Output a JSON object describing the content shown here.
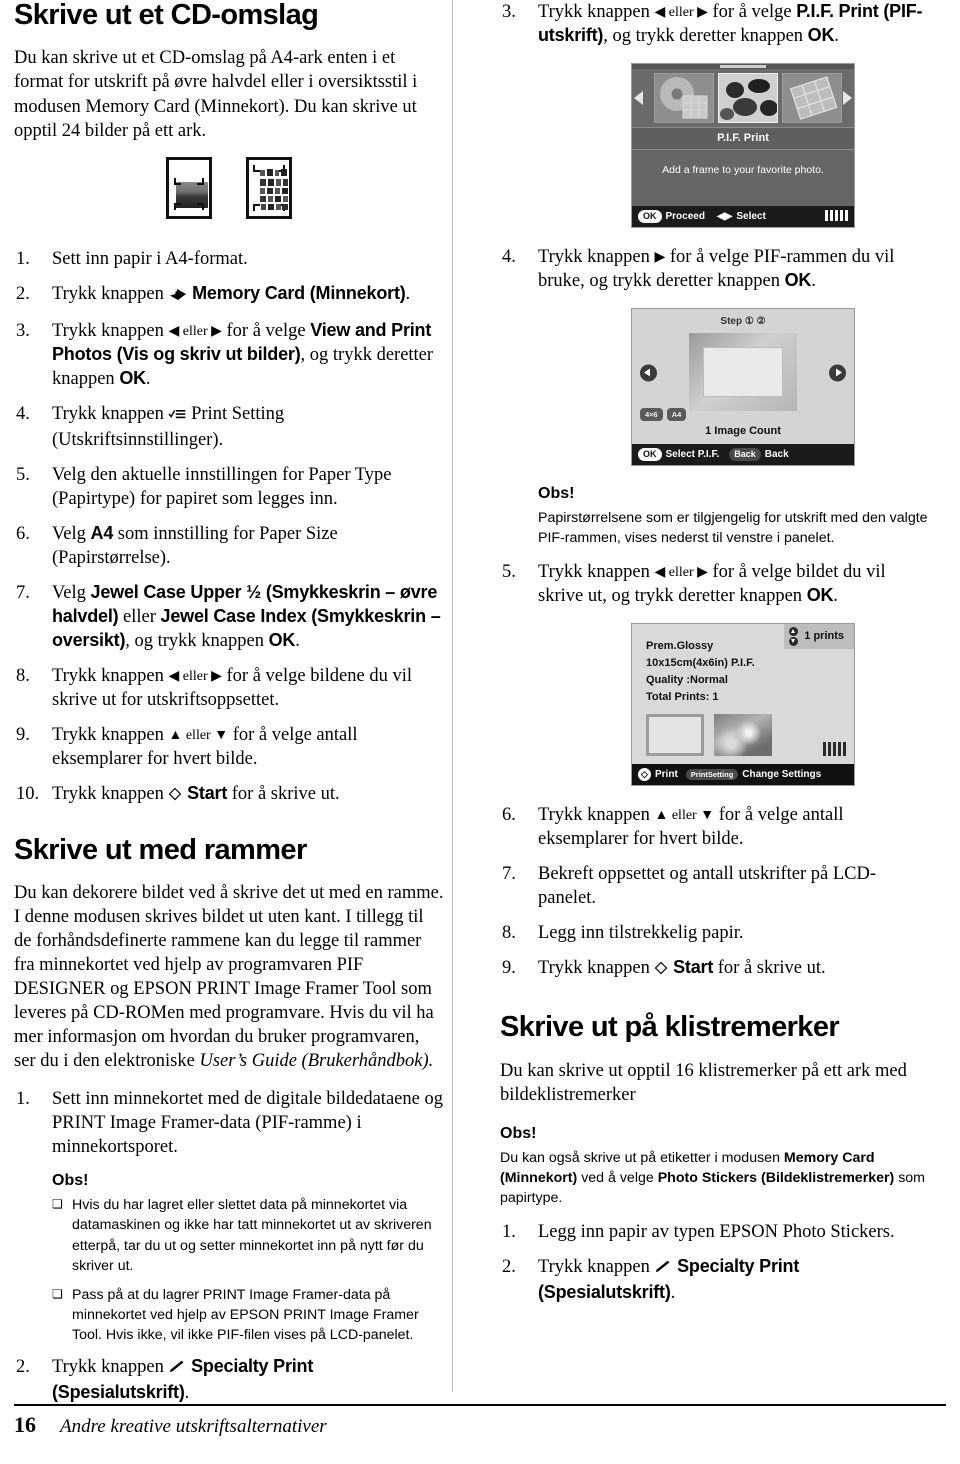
{
  "left_column": {
    "heading": "Skrive ut et CD-omslag",
    "intro": "Du kan skrive ut et CD-omslag på A4-ark enten i et format for utskrift på øvre halvdel eller i oversiktsstil i modusen Memory Card (Minnekort). Du kan skrive ut opptil 24 bilder på ett ark.",
    "steps": [
      {
        "num": "1.",
        "text": "Sett inn papir i A4-format."
      },
      {
        "num": "2.",
        "text": "Trykk knappen ",
        "icon": "memory-card-icon",
        "bold_sans": "Memory Card (Minnekort)",
        "tail": "."
      },
      {
        "num": "3.",
        "pre": "Trykk knappen ",
        "arrows": "◀ eller ▶",
        "mid": " for å velge ",
        "bold_sans": "View and Print Photos (Vis og skriv ut bilder)",
        "post": ", og trykk deretter knappen ",
        "bold_key": "OK",
        "tail": "."
      },
      {
        "num": "4.",
        "pre": "Trykk knappen ",
        "icon": "print-setting-icon",
        "text": " Print Setting (Utskriftsinnstillinger)."
      },
      {
        "num": "5.",
        "text": "Velg den aktuelle innstillingen for Paper Type (Papirtype) for papiret som legges inn."
      },
      {
        "num": "6.",
        "pre": "Velg ",
        "bold_key": "A4",
        "text": " som innstilling for Paper Size (Papirstørrelse)."
      },
      {
        "num": "7.",
        "pre": "Velg ",
        "bold_sans": "Jewel Case Upper ½ (Smykkeskrin – øvre halvdel)",
        "mid": " eller ",
        "bold_sans2": "Jewel Case Index (Smykkeskrin – oversikt)",
        "post": ", og trykk knappen ",
        "bold_key": "OK",
        "tail": "."
      },
      {
        "num": "8.",
        "pre": "Trykk knappen ",
        "arrows": "◀ eller ▶",
        "text": " for å velge bildene du vil skrive ut for utskriftsoppsettet."
      },
      {
        "num": "9.",
        "pre": "Trykk knappen ",
        "arrows": "▲ eller ▼",
        "text": " for å velge antall eksemplarer for hvert bilde."
      },
      {
        "num": "10.",
        "pre": "Trykk knappen ",
        "icon": "start-diamond-icon",
        "bold_sans": "Start",
        "text": " for å skrive ut."
      }
    ],
    "heading2": "Skrive ut med rammer",
    "intro2": "Du kan dekorere bildet ved å skrive det ut med en ramme. I denne modusen skrives bildet ut uten kant. I tillegg til de forhåndsdefinerte rammene kan du legge til rammer fra minnekortet ved hjelp av programvaren PIF DESIGNER og EPSON PRINT Image Framer Tool som leveres på CD-ROMen med programvare. Hvis du vil ha mer informasjon om hvordan du bruker programvaren, ser du i den elektroniske ",
    "intro2_italic": "User’s Guide (Brukerhåndbok).",
    "steps2": [
      {
        "num": "1.",
        "text": "Sett inn minnekortet med de digitale bildedataene og PRINT Image Framer-data (PIF-ramme) i minnekortsporet."
      }
    ],
    "note1": {
      "obs": "Obs!",
      "bullets": [
        "Hvis du har lagret eller slettet data på minnekortet via datamaskinen og ikke har tatt minnekortet ut av skriveren etterpå, tar du ut og setter minnekortet inn på nytt før du skriver ut.",
        "Pass på at du lagrer PRINT Image Framer-data på minnekortet ved hjelp av EPSON PRINT Image Framer Tool. Hvis ikke, vil ikke PIF-filen vises på LCD-panelet."
      ]
    },
    "step2_after_note": {
      "num": "2.",
      "pre": "Trykk knappen ",
      "icon": "specialty-print-icon",
      "bold_sans": "Specialty Print (Spesialutskrift)",
      "tail": "."
    }
  },
  "right_column": {
    "steps_top": [
      {
        "num": "3.",
        "pre": "Trykk knappen ",
        "arrows": "◀ eller ▶",
        "mid": " for å velge ",
        "bold_sans": "P.I.F. Print (PIF-utskrift)",
        "post": ", og trykk deretter knappen ",
        "bold_key": "OK",
        "tail": "."
      }
    ],
    "lcd1": {
      "label": "P.I.F. Print",
      "description": "Add a frame to your favorite photo.",
      "footer_ok": "OK",
      "footer_ok_text": "Proceed",
      "footer_select_text": "Select"
    },
    "step4": {
      "num": "4.",
      "pre": "Trykk knappen ",
      "arrows": "▶",
      "text": " for å velge PIF-rammen du vil bruke, og trykk deretter knappen ",
      "bold_key": "OK",
      "tail": "."
    },
    "lcd2": {
      "step_label": "Step",
      "step_1": "①",
      "step_2": "②",
      "size1": "4×6",
      "size2": "A4",
      "count": "1 Image Count",
      "footer_ok": "OK",
      "footer_ok_text": "Select P.I.F.",
      "footer_back_key": "Back",
      "footer_back_text": "Back"
    },
    "note2": {
      "obs": "Obs!",
      "text": "Papirstørrelsene som er tilgjengelig for utskrift med den valgte PIF-rammen, vises nederst til venstre i panelet."
    },
    "step5": {
      "num": "5.",
      "pre": "Trykk knappen ",
      "arrows": "◀ eller ▶",
      "text": " for å velge bildet du vil skrive ut, og trykk deretter knappen ",
      "bold_key": "OK",
      "tail": "."
    },
    "lcd3": {
      "prints": "1  prints",
      "line1": "Prem.Glossy",
      "line2": "10x15cm(4x6in) P.I.F.",
      "line3": "Quality :Normal",
      "line4": "Total Prints: 1",
      "footer_print": "Print",
      "footer_key": "PrintSetting",
      "footer_change": "Change Settings"
    },
    "steps_bottom": [
      {
        "num": "6.",
        "pre": "Trykk knappen ",
        "arrows": "▲ eller ▼",
        "text": " for å velge antall eksemplarer for hvert bilde."
      },
      {
        "num": "7.",
        "text": "Bekreft oppsettet og antall utskrifter på LCD-panelet."
      },
      {
        "num": "8.",
        "text": "Legg inn tilstrekkelig papir."
      },
      {
        "num": "9.",
        "pre": "Trykk knappen ",
        "icon": "start-diamond-icon",
        "bold_sans": "Start",
        "text": " for å skrive ut."
      }
    ],
    "heading3": "Skrive ut på klistremerker",
    "intro3": "Du kan skrive ut opptil 16 klistremerker på ett ark med bildeklistremerker",
    "note3": {
      "obs": "Obs!",
      "pre": "Du kan også skrive ut på etiketter i modusen ",
      "bold1": "Memory Card (Minnekort)",
      "mid": " ved å velge ",
      "bold2": "Photo Stickers (Bildeklistremerker)",
      "post": " som papirtype."
    },
    "steps3": [
      {
        "num": "1.",
        "text": "Legg inn papir av typen EPSON Photo Stickers."
      },
      {
        "num": "2.",
        "pre": "Trykk knappen ",
        "icon": "specialty-print-icon",
        "bold_sans": "Specialty Print (Spesialutskrift)",
        "tail": "."
      }
    ]
  },
  "footer": {
    "page_number": "16",
    "title": "Andre kreative utskriftsalternativer"
  },
  "colors": {
    "text": "#000000",
    "divider": "#bdbdbd",
    "lcd_dark": "#1b1b1b",
    "lcd_light": "#d8d8d8"
  }
}
